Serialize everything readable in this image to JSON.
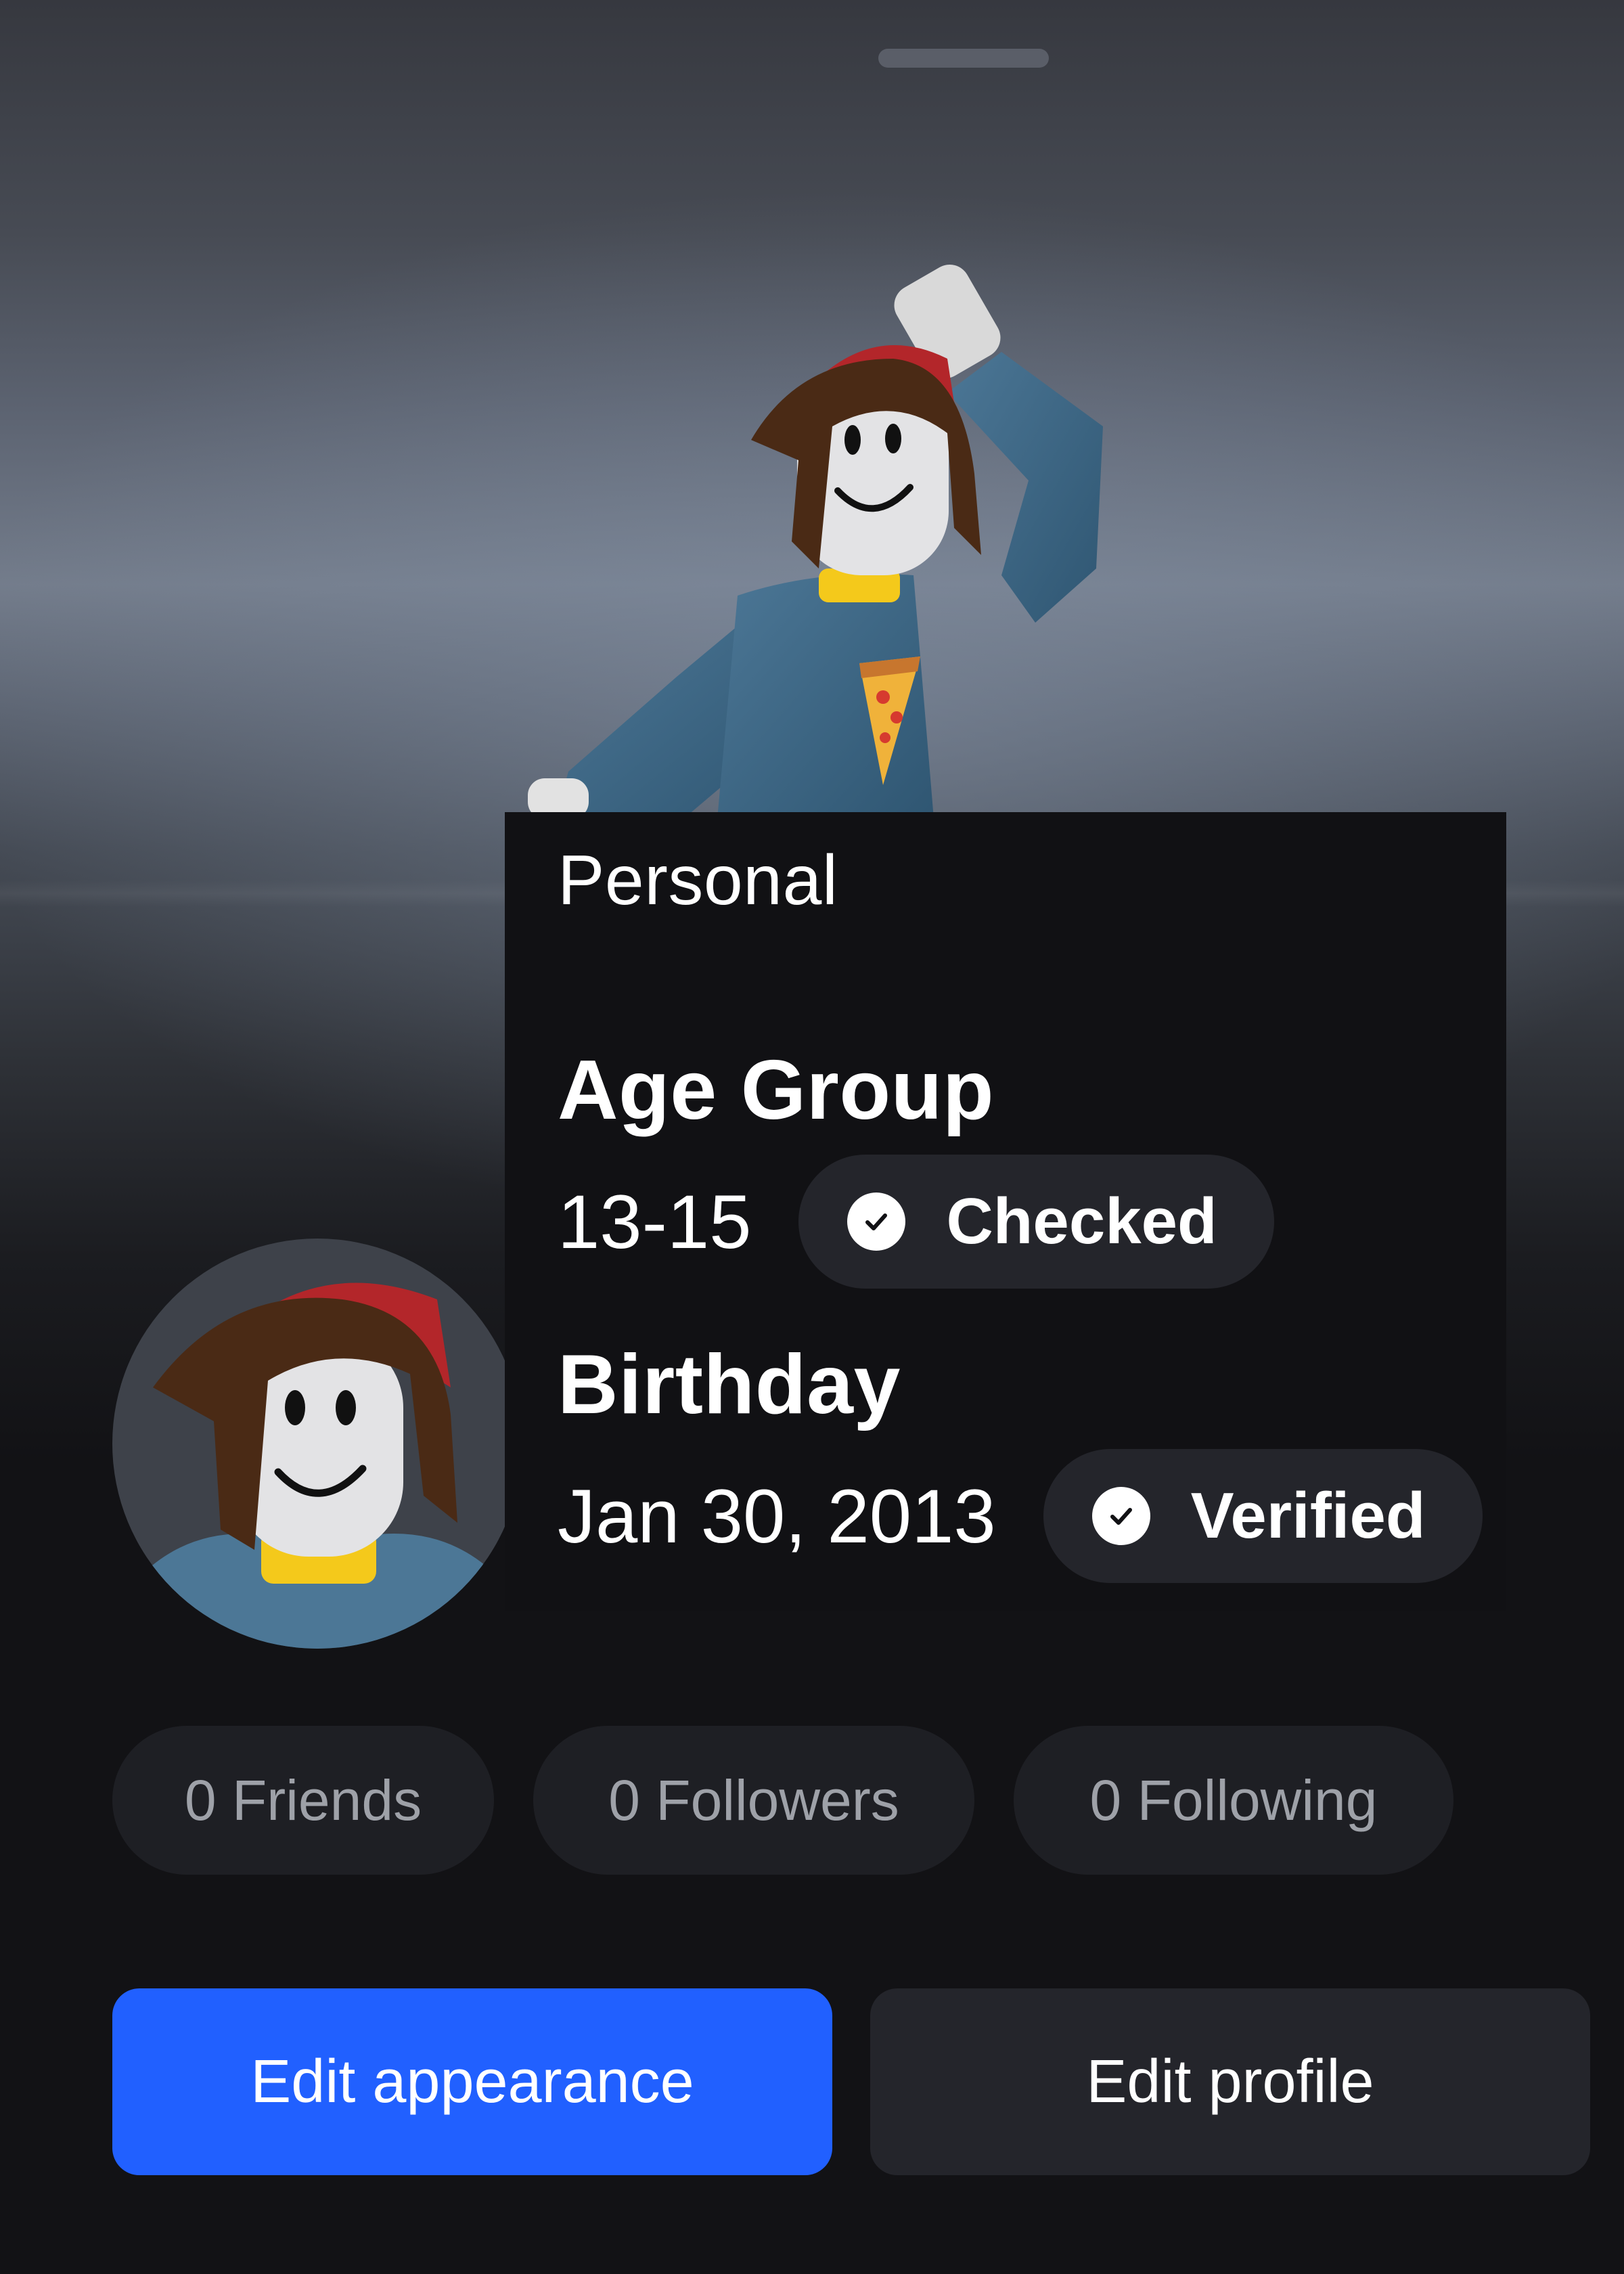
{
  "popover": {
    "section_label": "Personal",
    "age_group": {
      "title": "Age Group",
      "value": "13-15",
      "badge": "Checked",
      "badge_icon": "check-circle-icon"
    },
    "birthday": {
      "title": "Birthday",
      "value": "Jan 30, 2013",
      "badge": "Verified",
      "badge_icon": "check-circle-icon"
    }
  },
  "stats": {
    "friends": "0 Friends",
    "followers": "0 Followers",
    "following": "0 Following"
  },
  "actions": {
    "edit_appearance": "Edit appearance",
    "edit_profile": "Edit profile"
  },
  "colors": {
    "accent": "#2160ff",
    "surface": "#24252b",
    "background": "#121215"
  }
}
